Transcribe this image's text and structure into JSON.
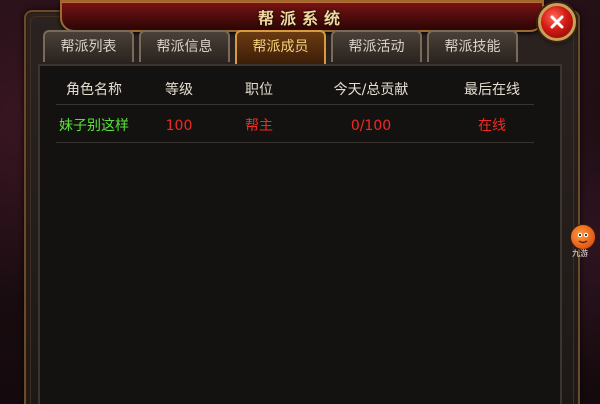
{
  "window": {
    "title": "帮派系统"
  },
  "tabs": [
    {
      "label": "帮派列表",
      "active": false
    },
    {
      "label": "帮派信息",
      "active": false
    },
    {
      "label": "帮派成员",
      "active": true
    },
    {
      "label": "帮派活动",
      "active": false
    },
    {
      "label": "帮派技能",
      "active": false
    }
  ],
  "table": {
    "headers": [
      "角色名称",
      "等级",
      "职位",
      "今天/总贡献",
      "最后在线"
    ],
    "rows": [
      {
        "name": "妹子别这样",
        "level": "100",
        "position": "帮主",
        "contribution": "0/100",
        "last_online": "在线"
      }
    ]
  },
  "side_widget": {
    "label": "九游"
  },
  "colors": {
    "member_name": "#58e13a",
    "highlight_red": "#f02a22",
    "active_tab_text": "#f5d27a",
    "close_button": "#d21b14"
  },
  "icons": {
    "close": "close-icon",
    "side_widget": "mascot-icon"
  }
}
